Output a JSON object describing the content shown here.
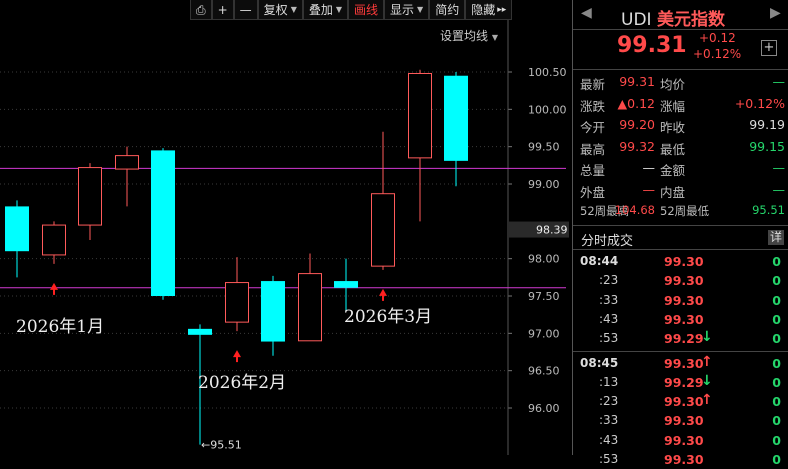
{
  "toolbar": {
    "buttons": [
      {
        "label": "⎙",
        "dropdown": false
      },
      {
        "label": "+",
        "dropdown": false
      },
      {
        "label": "—",
        "dropdown": false
      },
      {
        "label": "复权",
        "dropdown": true
      },
      {
        "label": "叠加",
        "dropdown": true
      },
      {
        "label": "画线",
        "dropdown": false,
        "active": true
      },
      {
        "label": "显示",
        "dropdown": true
      },
      {
        "label": "简约",
        "dropdown": false
      },
      {
        "label": "隐藏",
        "dropdown": false,
        "suffix": "▸▸"
      }
    ]
  },
  "chart": {
    "set_ma_label": "设置均线",
    "dropdown_icon": "triangle-down-icon",
    "current_price_tag": "98.39",
    "low_marker": "←95.51",
    "month_labels": [
      "2026年1月",
      "2026年2月",
      "2026年3月"
    ],
    "colors": {
      "up": "#ff5a5a",
      "down": "#00ffff",
      "line": "#d33ad3",
      "marker": "#ff2020"
    }
  },
  "chart_data": {
    "type": "candlestick",
    "y_ticks": [
      100.5,
      100.0,
      99.5,
      99.0,
      98.0,
      97.5,
      97.0,
      96.5,
      96.0
    ],
    "y_tick_labels": [
      "100.50",
      "100.00",
      "99.50",
      "99.00",
      "98.00",
      "97.50",
      "97.00",
      "96.50",
      "96.00"
    ],
    "ylim": [
      95.4,
      100.8
    ],
    "horizontal_lines": [
      99.21,
      97.61
    ],
    "candles": [
      {
        "open": 98.1,
        "close": 98.7,
        "high": 98.78,
        "low": 97.75,
        "dir": "down"
      },
      {
        "open": 98.05,
        "close": 98.45,
        "high": 98.5,
        "low": 97.93,
        "dir": "up"
      },
      {
        "open": 98.45,
        "close": 99.22,
        "high": 99.28,
        "low": 98.25,
        "dir": "up"
      },
      {
        "open": 99.2,
        "close": 99.38,
        "high": 99.5,
        "low": 98.7,
        "dir": "up"
      },
      {
        "open": 99.45,
        "close": 97.5,
        "high": 99.48,
        "low": 97.45,
        "dir": "down"
      },
      {
        "open": 97.06,
        "close": 96.98,
        "high": 97.12,
        "low": 95.51,
        "dir": "down"
      },
      {
        "open": 97.15,
        "close": 97.68,
        "high": 98.02,
        "low": 97.03,
        "dir": "up"
      },
      {
        "open": 97.7,
        "close": 96.89,
        "high": 97.77,
        "low": 96.7,
        "dir": "down"
      },
      {
        "open": 96.9,
        "close": 97.8,
        "high": 98.07,
        "low": 96.9,
        "dir": "up"
      },
      {
        "open": 97.7,
        "close": 97.61,
        "high": 98.0,
        "low": 97.3,
        "dir": "down"
      },
      {
        "open": 97.9,
        "close": 98.87,
        "high": 99.7,
        "low": 97.85,
        "dir": "up"
      },
      {
        "open": 99.35,
        "close": 100.48,
        "high": 100.53,
        "low": 98.5,
        "dir": "up"
      },
      {
        "open": 100.45,
        "close": 99.31,
        "high": 100.5,
        "low": 98.97,
        "dir": "down"
      }
    ],
    "up_markers_at_candles": [
      1,
      6,
      10
    ]
  },
  "panel": {
    "prev_icon": "◀",
    "next_icon": "▶",
    "code": "UDI",
    "name": "美元指数",
    "price": "99.31",
    "change": "+0.12",
    "change_pct": "+0.12%",
    "add_icon": "+",
    "stats": [
      {
        "l1": "最新",
        "v1": "99.31",
        "c1": "red",
        "l2": "均价",
        "v2": "—",
        "c2": "grn"
      },
      {
        "l1": "涨跌",
        "v1": "▲0.12",
        "c1": "red",
        "l2": "涨幅",
        "v2": "+0.12%",
        "c2": "red"
      },
      {
        "l1": "今开",
        "v1": "99.20",
        "c1": "red",
        "l2": "昨收",
        "v2": "99.19",
        "c2": "wht"
      },
      {
        "l1": "最高",
        "v1": "99.32",
        "c1": "red",
        "l2": "最低",
        "v2": "99.15",
        "c2": "grn"
      },
      {
        "l1": "总量",
        "v1": "—",
        "c1": "wht",
        "l2": "金额",
        "v2": "—",
        "c2": "grn"
      },
      {
        "l1": "外盘",
        "v1": "—",
        "c1": "red",
        "l2": "内盘",
        "v2": "—",
        "c2": "grn"
      },
      {
        "l1": "52周最高",
        "v1": "104.68",
        "c1": "red",
        "l2": "52周最低",
        "v2": "95.51",
        "c2": "grn"
      }
    ],
    "trades_title": "分时成交",
    "detail_label": "详",
    "trades": [
      {
        "time": "08:44",
        "price": "99.30",
        "vol": "0",
        "arrow": "",
        "major": true
      },
      {
        "time": ":23",
        "price": "99.30",
        "vol": "0",
        "arrow": ""
      },
      {
        "time": ":33",
        "price": "99.30",
        "vol": "0",
        "arrow": ""
      },
      {
        "time": ":43",
        "price": "99.30",
        "vol": "0",
        "arrow": ""
      },
      {
        "time": ":53",
        "price": "99.29",
        "vol": "0",
        "arrow": "down"
      },
      {
        "time": "08:45",
        "price": "99.30",
        "vol": "0",
        "arrow": "up",
        "major": true
      },
      {
        "time": ":13",
        "price": "99.29",
        "vol": "0",
        "arrow": "down"
      },
      {
        "time": ":23",
        "price": "99.30",
        "vol": "0",
        "arrow": "up"
      },
      {
        "time": ":33",
        "price": "99.30",
        "vol": "0",
        "arrow": ""
      },
      {
        "time": ":43",
        "price": "99.30",
        "vol": "0",
        "arrow": ""
      },
      {
        "time": ":53",
        "price": "99.30",
        "vol": "0",
        "arrow": ""
      }
    ]
  }
}
